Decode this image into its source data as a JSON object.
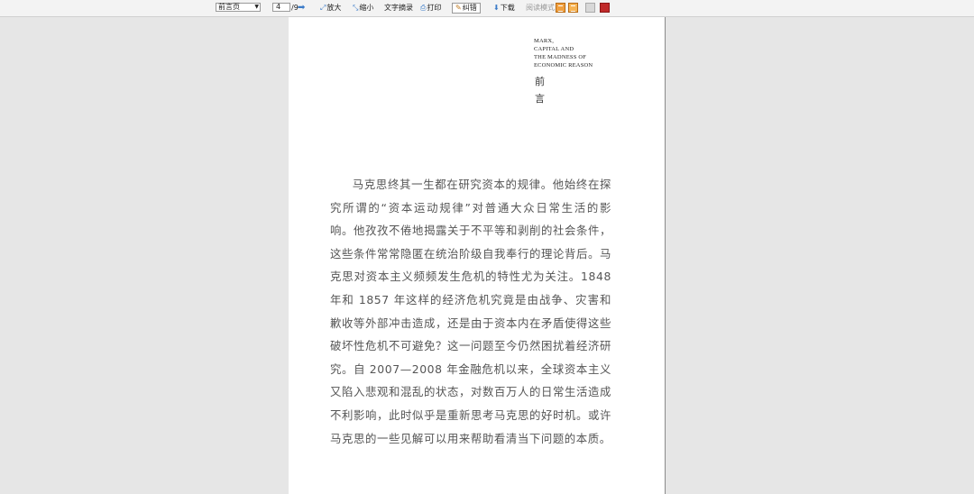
{
  "toolbar": {
    "page_select": "前言页",
    "page_number": "4",
    "page_total": "/9",
    "zoom_in": "放大",
    "zoom_out": "缩小",
    "text_extract": "文字摘录",
    "print": "打印",
    "notes": "纠错",
    "download": "下载",
    "read_mode": "阅读模式:"
  },
  "page": {
    "header_en": [
      "MARX,",
      "CAPITAL AND",
      "THE MADNESS OF",
      "ECONOMIC REASON"
    ],
    "header_cn": [
      "前",
      "言"
    ],
    "body": "马克思终其一生都在研究资本的规律。他始终在探究所谓的“资本运动规律”对普通大众日常生活的影响。他孜孜不倦地揭露关于不平等和剥削的社会条件，这些条件常常隐匿在统治阶级自我奉行的理论背后。马克思对资本主义频频发生危机的特性尤为关注。1848 年和 1857 年这样的经济危机究竟是由战争、灾害和歉收等外部冲击造成，还是由于资本内在矛盾使得这些破坏性危机不可避免？这一问题至今仍然困扰着经济研究。自 2007—2008 年金融危机以来，全球资本主义又陷入悲观和混乱的状态，对数百万人的日常生活造成不利影响，此时似乎是重新思考马克思的好时机。或许马克思的一些见解可以用来帮助看清当下问题的本质。"
  }
}
